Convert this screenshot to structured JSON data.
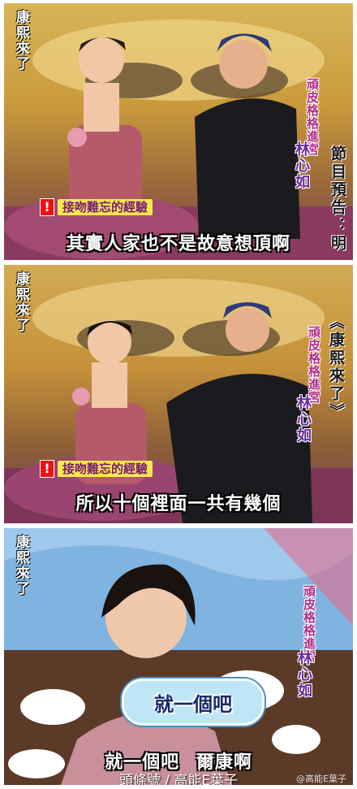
{
  "panels": [
    {
      "logo": "康熙來了",
      "segment": "頑皮格格進宮",
      "guest": "林心如",
      "promo": "節目預告：明",
      "topic": "接吻難忘的經驗",
      "subtitle": "其實人家也不是故意想頂啊"
    },
    {
      "logo": "康熙來了",
      "segment": "頑皮格格進宮",
      "guest": "林心如",
      "promo": "《康熙來了》",
      "topic": "接吻難忘的經驗",
      "subtitle": "所以十個裡面一共有幾個"
    },
    {
      "logo": "康熙來了",
      "segment": "頑皮格格進宮",
      "guest": "林心如",
      "bubble": "就一個吧",
      "subtitle": "就一個吧",
      "subtitle2": "爾康啊"
    }
  ],
  "watermark": "頭條號 / 高能E葉子",
  "watermark_small": "@高能E葉子"
}
